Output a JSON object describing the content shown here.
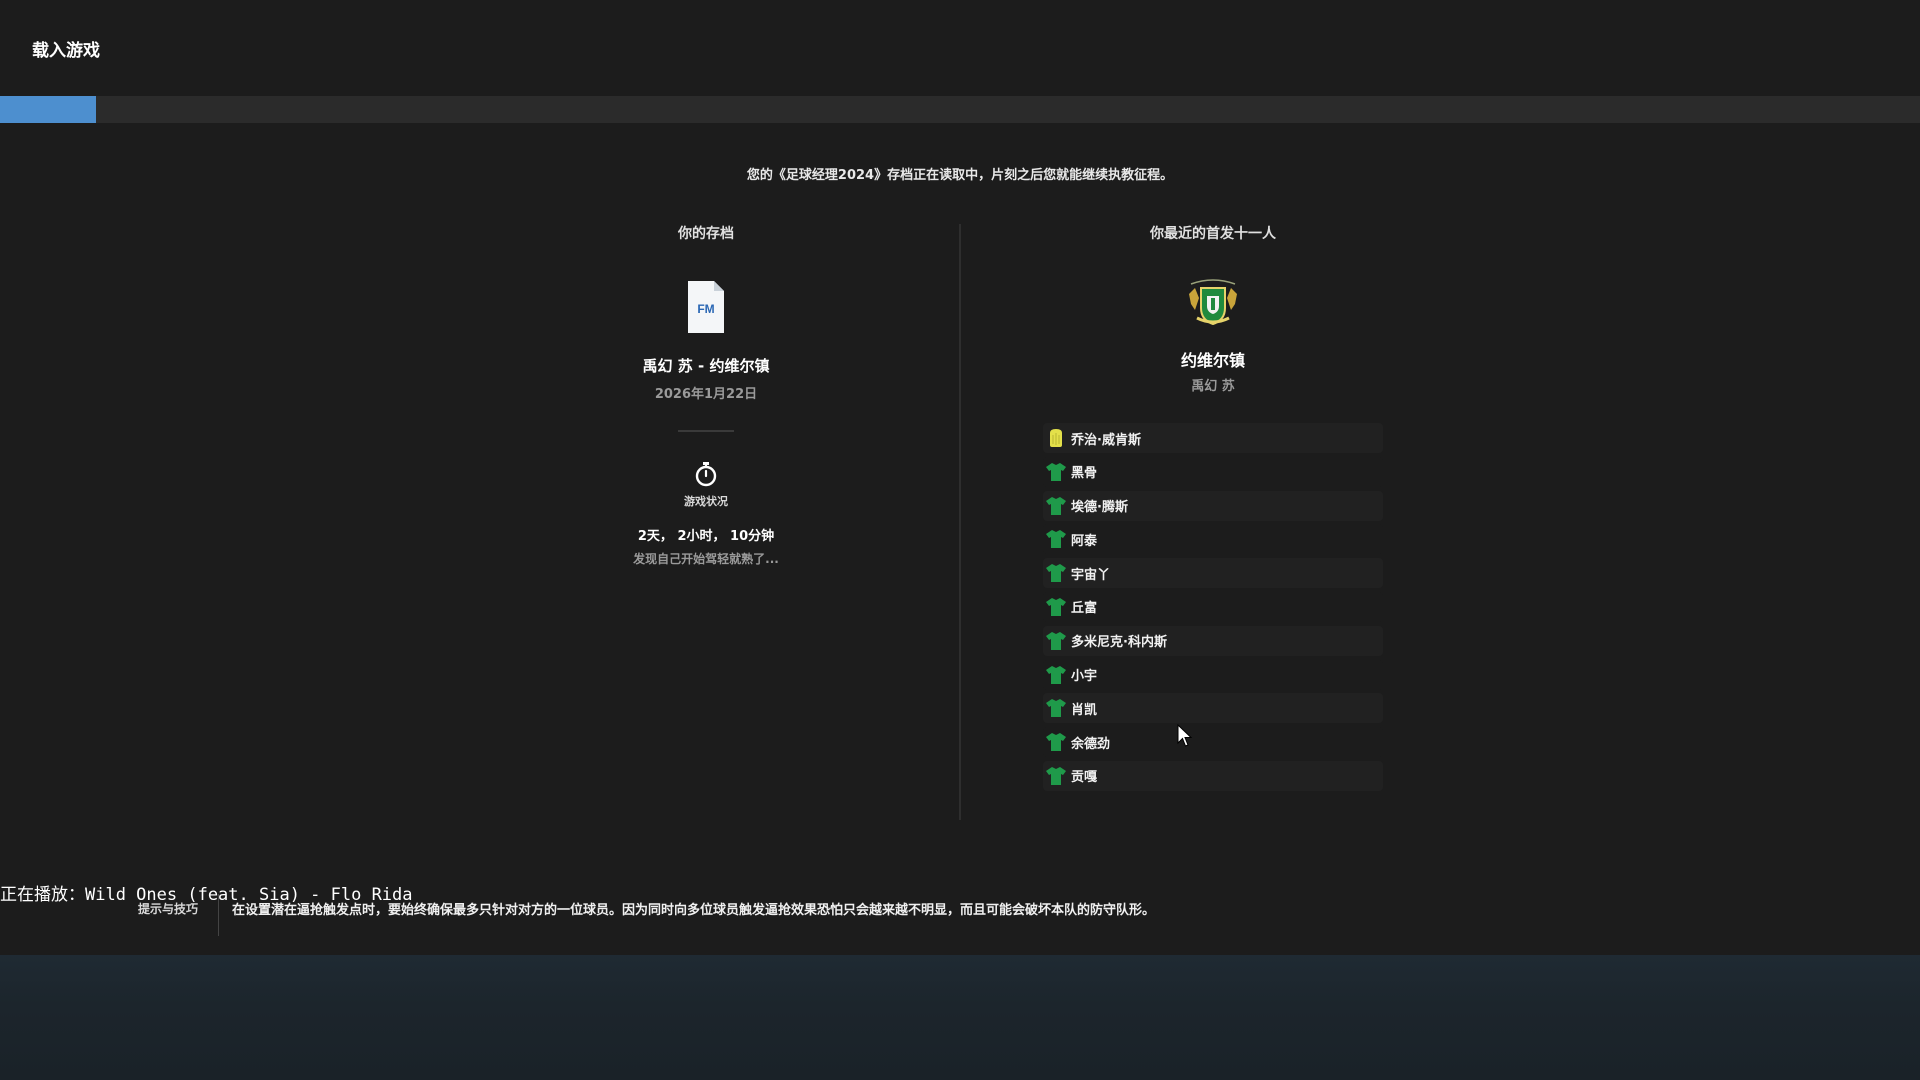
{
  "window": {
    "title": "载入游戏"
  },
  "progress": {
    "value_percent": 5,
    "color": "#4d8fcf"
  },
  "intro_message": "您的《足球经理2024》存档正在读取中，片刻之后您就能继续执教征程。",
  "save": {
    "heading": "你的存档",
    "file_icon": "fm-save-file-icon",
    "file_icon_text": "FM",
    "name": "禹幻 苏 - 约维尔镇",
    "date": "2026年1月22日",
    "status_icon": "stopwatch-icon",
    "status_label": "游戏状况",
    "play_time": "2天， 2小时， 10分钟",
    "play_description": "发现自己开始驾轻就熟了..."
  },
  "lineup": {
    "heading": "你最近的首发十一人",
    "club_crest": "yeovil-town-crest-icon",
    "club_name": "约维尔镇",
    "manager": "禹幻 苏",
    "kit_colors": {
      "goalkeeper": "#e3e04a",
      "outfield": "#1f9a4a"
    },
    "players": [
      {
        "name": "乔治·威肯斯",
        "role": "goalkeeper"
      },
      {
        "name": "黑骨",
        "role": "outfield"
      },
      {
        "name": "埃德·腾斯",
        "role": "outfield"
      },
      {
        "name": "阿泰",
        "role": "outfield"
      },
      {
        "name": "宇宙丫",
        "role": "outfield"
      },
      {
        "name": "丘富",
        "role": "outfield"
      },
      {
        "name": "多米尼克·科内斯",
        "role": "outfield"
      },
      {
        "name": "小宇",
        "role": "outfield"
      },
      {
        "name": "肖凯",
        "role": "outfield"
      },
      {
        "name": "余德劲",
        "role": "outfield"
      },
      {
        "name": "贡嘎",
        "role": "outfield"
      }
    ]
  },
  "overlay": {
    "now_playing": "正在播放：Wild Ones (feat. Sia) - Flo Rida"
  },
  "tips": {
    "label": "提示与技巧",
    "text": "在设置潜在逼抢触发点时，要始终确保最多只针对对方的一位球员。因为同时向多位球员触发逼抢效果恐怕只会越来越不明显，而且可能会破坏本队的防守队形。"
  }
}
